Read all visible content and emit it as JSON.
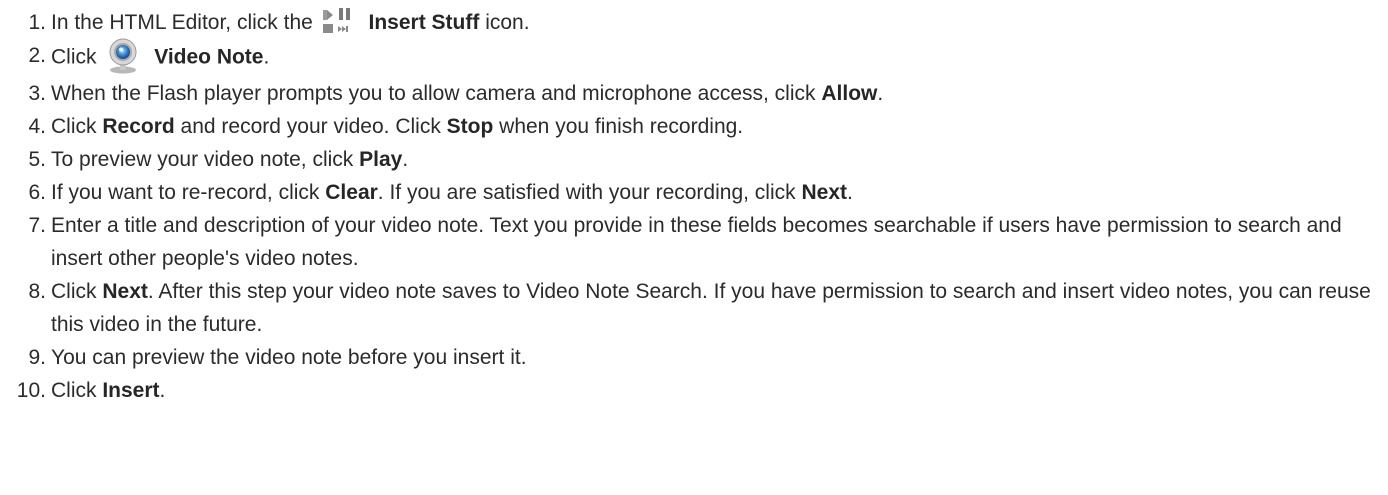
{
  "steps": [
    {
      "number": "1.",
      "pre": "In the HTML Editor, click the",
      "icon": "insert-stuff-icon",
      "bold": "Insert Stuff",
      "post": " icon."
    },
    {
      "number": "2.",
      "pre": "Click",
      "icon": "webcam-icon",
      "bold": "Video Note",
      "post": "."
    },
    {
      "number": "3.",
      "pre": "When the Flash player prompts you to allow camera and microphone access, click ",
      "bold": "Allow",
      "post": "."
    },
    {
      "number": "4.",
      "pre": "Click ",
      "bold": "Record",
      "mid": " and record your video. Click ",
      "bold2": "Stop",
      "post": " when you finish recording."
    },
    {
      "number": "5.",
      "pre": "To preview your video note, click ",
      "bold": "Play",
      "post": "."
    },
    {
      "number": "6.",
      "pre": "If you want to re-record, click ",
      "bold": "Clear",
      "mid": ". If you are satisfied with your recording, click ",
      "bold2": "Next",
      "post": "."
    },
    {
      "number": "7.",
      "text": "Enter a title and description of your video note. Text you provide in these fields becomes searchable if users have permission to search and insert other people's video notes."
    },
    {
      "number": "8.",
      "pre": "Click ",
      "bold": "Next",
      "post": ". After this step your video note saves to Video Note Search. If you have permission to search and insert video notes, you can reuse this video in the future."
    },
    {
      "number": "9.",
      "text": "You can preview the video note before you insert it."
    },
    {
      "number": "10.",
      "pre": "Click ",
      "bold": "Insert",
      "post": "."
    }
  ]
}
